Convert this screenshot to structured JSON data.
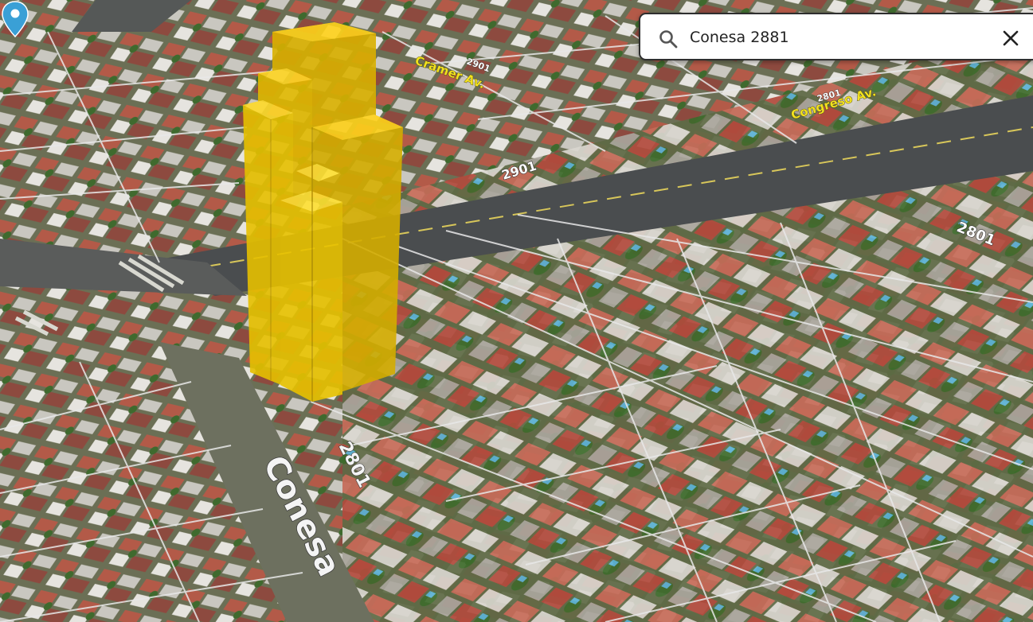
{
  "search": {
    "value": "Conesa 2881",
    "placeholder": ""
  },
  "streets": [
    {
      "name": "Cramer Av.",
      "number": "2901"
    },
    {
      "name": "Congreso Av.",
      "number": "2801"
    },
    {
      "name": "",
      "number": "2901"
    },
    {
      "name": "",
      "number": "2801"
    },
    {
      "name": "Conesa",
      "number": "2801"
    }
  ],
  "icons": {
    "search": "search-icon",
    "close": "close-icon",
    "pin": "map-pin-icon"
  },
  "colors": {
    "building_highlight": "#f2c700",
    "pin": "#3aa0d6",
    "parcel_outline": "#e8e8e8"
  }
}
